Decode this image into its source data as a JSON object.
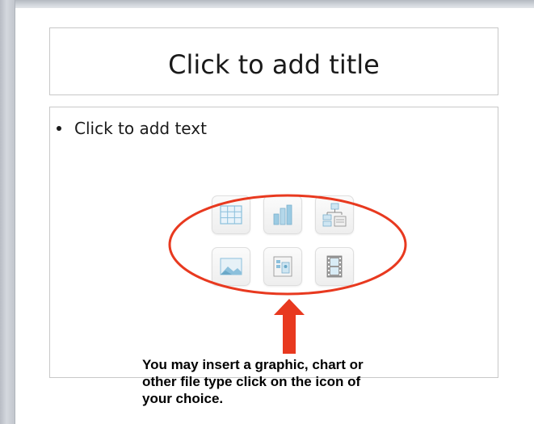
{
  "slide": {
    "title_placeholder": "Click to add title",
    "content_placeholder": "Click to add text"
  },
  "insert_icons": [
    {
      "name": "table-icon"
    },
    {
      "name": "chart-icon"
    },
    {
      "name": "smartart-icon"
    },
    {
      "name": "picture-icon"
    },
    {
      "name": "clip-art-icon"
    },
    {
      "name": "media-clip-icon"
    }
  ],
  "annotation": {
    "callout_line1": "You may insert a graphic, chart or",
    "callout_line2": "other file type click on the icon of",
    "callout_line3": "your choice.",
    "highlight_color": "#e8391f",
    "arrow_color": "#e8391f"
  },
  "colors": {
    "window_frame": "#c7cbd1",
    "placeholder_border": "#c8c8c8",
    "icon_blue": "#8cc0dc"
  }
}
